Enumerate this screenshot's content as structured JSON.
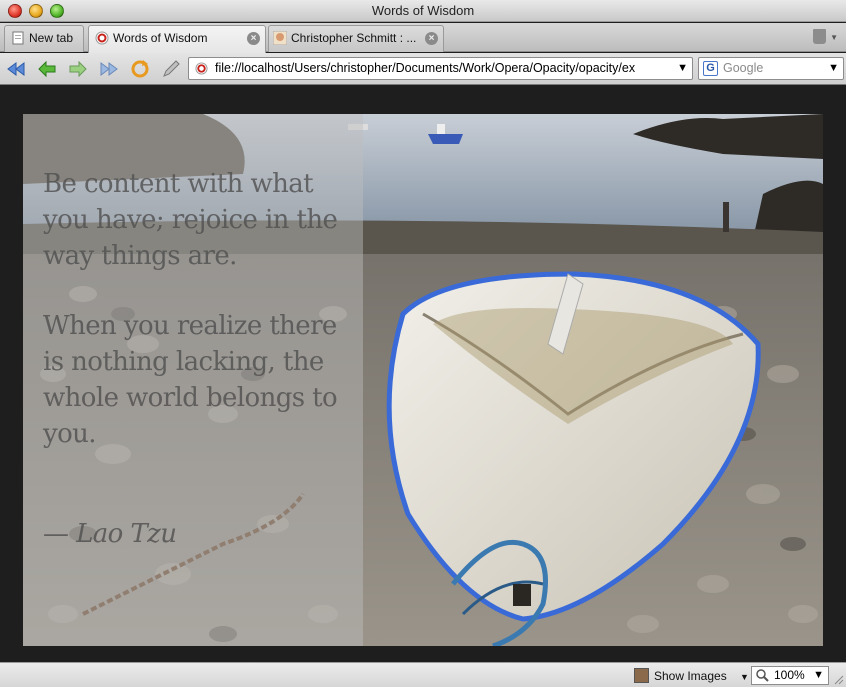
{
  "window": {
    "title": "Words of Wisdom"
  },
  "tabs": [
    {
      "label": "New tab"
    },
    {
      "label": "Words of Wisdom"
    },
    {
      "label": "Christopher Schmitt : ..."
    }
  ],
  "toolbar": {
    "url": "file://localhost/Users/christopher/Documents/Work/Opera/Opacity/opacity/ex",
    "search_placeholder": "Google"
  },
  "content": {
    "quote_1": "Be content with what you have; rejoice in the way things are.",
    "quote_2": "When you realize there is nothing lacking, the whole world belongs to you.",
    "attribution": "— Lao Tzu"
  },
  "statusbar": {
    "show_images": "Show Images",
    "zoom": "100%"
  },
  "colors": {
    "page_background": "#1e1e1e",
    "quote_text": "#505050",
    "boat_trim": "#3a6ad8"
  },
  "icons": [
    "back-icon",
    "rewind-icon",
    "forward-icon",
    "fast-forward-icon",
    "reload-icon",
    "edit-icon",
    "opera-page-icon",
    "google-icon",
    "trash-icon",
    "zoom-icon"
  ]
}
